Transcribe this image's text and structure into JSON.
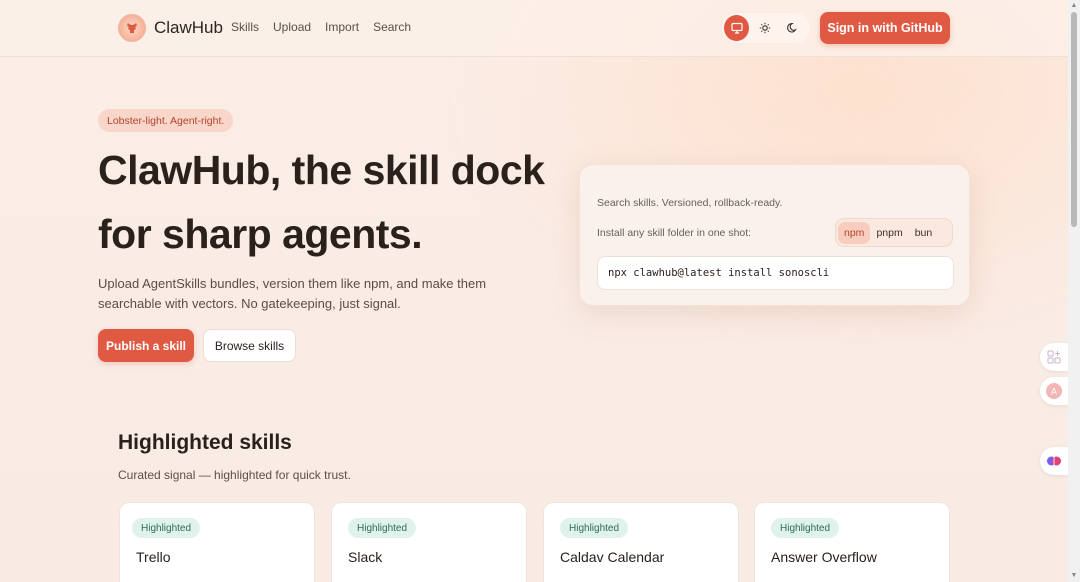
{
  "header": {
    "brand": "ClawHub",
    "nav": [
      "Skills",
      "Upload",
      "Import",
      "Search"
    ],
    "signin_label": "Sign in  with GitHub"
  },
  "hero": {
    "tagline": "Lobster-light. Agent-right.",
    "title_line1": "ClawHub, the skill dock",
    "title_line2": "for sharp agents.",
    "subtitle": "Upload AgentSkills bundles, version them like npm, and make them searchable with vectors. No gatekeeping, just signal.",
    "publish_label": "Publish a skill",
    "browse_label": "Browse skills"
  },
  "install": {
    "line1": "Search skills. Versioned, rollback-ready.",
    "line2": "Install any skill folder in one shot:",
    "tabs": [
      "npm",
      "pnpm",
      "bun"
    ],
    "active_tab": "npm",
    "command": "npx clawhub@latest install sonoscli"
  },
  "highlighted": {
    "title": "Highlighted skills",
    "subtitle": "Curated signal — highlighted for quick trust.",
    "cards": [
      {
        "badge": "Highlighted",
        "name": "Trello"
      },
      {
        "badge": "Highlighted",
        "name": "Slack"
      },
      {
        "badge": "Highlighted",
        "name": "Caldav Calendar"
      },
      {
        "badge": "Highlighted",
        "name": "Answer Overflow"
      }
    ]
  },
  "icons": {
    "theme": [
      "monitor-icon",
      "sun-icon",
      "moon-icon"
    ],
    "side": [
      "app-grid-icon",
      "translate-icon",
      "brain-icon"
    ]
  },
  "colors": {
    "accent": "#e05a43",
    "badge_bg": "#dff2ec",
    "badge_text": "#2f6b5c"
  }
}
